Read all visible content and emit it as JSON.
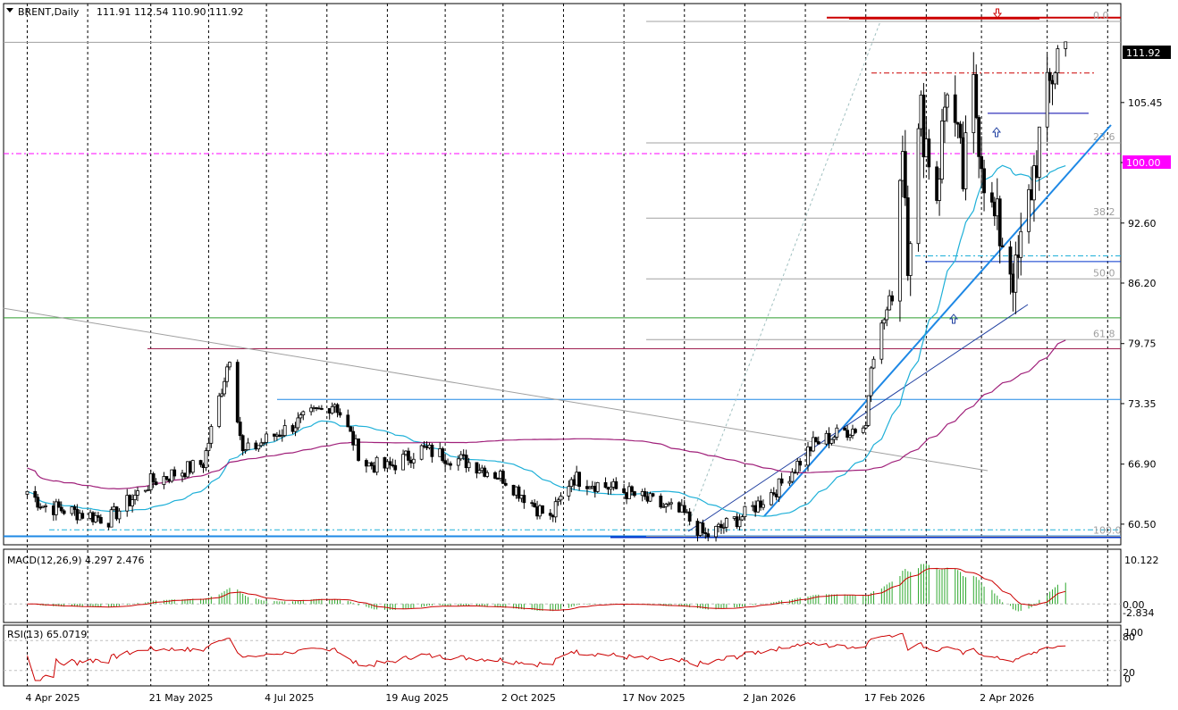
{
  "header": {
    "symbol_label": "BRENT,Daily",
    "ohlc": "111.91 112.54 110.90 111.92"
  },
  "macd_panel": {
    "label": "MACD(12,26,9) 4.297 2.476",
    "ticks": [
      "10.122",
      "0.00",
      "-2.834"
    ]
  },
  "rsi_panel": {
    "label": "RSI(13) 65.0719",
    "ticks": [
      "100",
      "80",
      "20",
      "0"
    ]
  },
  "levels": {
    "price_badge": "111.92",
    "round_badge": "100.00"
  },
  "fib_labels": [
    "0.0",
    "23.6",
    "38.2",
    "50.0",
    "61.8",
    "100.0"
  ],
  "colors": {
    "bull": "#000000",
    "bear": "#000000",
    "ma_fast": "#1fb0d8",
    "ma_slow": "#a0207a",
    "trend_blue": "#1e88e5",
    "support": "#0033cc",
    "resistance": "#cc0000",
    "round_level": "#ff00ff",
    "macd_hist": "#2ea82e",
    "macd_signal": "#cc0000",
    "rsi_line": "#cc0000"
  },
  "icons": {
    "up_arrow": "up-arrow-icon",
    "down_arrow": "down-arrow-icon",
    "menu": "chevron-down-icon"
  },
  "chart_data": {
    "type": "candlestick",
    "y_ticks": [
      "111.92",
      "105.45",
      "99.05",
      "92.60",
      "86.20",
      "79.75",
      "73.35",
      "66.90",
      "60.50"
    ],
    "x_ticks": [
      "4 Apr 2025",
      "21 May 2025",
      "4 Jul 2025",
      "19 Aug 2025",
      "2 Oct 2025",
      "17 Nov 2025",
      "2 Jan 2026",
      "17 Feb 2026",
      "2 Apr 2026"
    ],
    "ylim": [
      58.3,
      116.0
    ],
    "last_close": 111.92,
    "grid": "vertical-dashed",
    "series": [
      {
        "name": "BRENT,Daily"
      }
    ],
    "anchors": [
      {
        "date": "2025-04-04",
        "price": 64.0
      },
      {
        "date": "2025-04-10",
        "price": 62.5
      },
      {
        "date": "2025-05-05",
        "price": 61.0
      },
      {
        "date": "2025-05-21",
        "price": 65.0
      },
      {
        "date": "2025-06-10",
        "price": 67.0
      },
      {
        "date": "2025-06-20",
        "price": 78.5
      },
      {
        "date": "2025-06-25",
        "price": 68.0
      },
      {
        "date": "2025-07-04",
        "price": 69.5
      },
      {
        "date": "2025-07-30",
        "price": 73.5
      },
      {
        "date": "2025-08-10",
        "price": 67.0
      },
      {
        "date": "2025-08-19",
        "price": 66.5
      },
      {
        "date": "2025-09-01",
        "price": 68.5
      },
      {
        "date": "2025-09-20",
        "price": 67.0
      },
      {
        "date": "2025-10-02",
        "price": 65.5
      },
      {
        "date": "2025-10-20",
        "price": 61.0
      },
      {
        "date": "2025-10-28",
        "price": 65.5
      },
      {
        "date": "2025-11-17",
        "price": 64.0
      },
      {
        "date": "2025-12-10",
        "price": 61.5
      },
      {
        "date": "2025-12-18",
        "price": 59.2
      },
      {
        "date": "2026-01-02",
        "price": 61.5
      },
      {
        "date": "2026-01-15",
        "price": 64.5
      },
      {
        "date": "2026-01-28",
        "price": 69.0
      },
      {
        "date": "2026-02-10",
        "price": 70.5
      },
      {
        "date": "2026-02-17",
        "price": 71.0
      },
      {
        "date": "2026-02-19",
        "price": 78.0
      },
      {
        "date": "2026-02-27",
        "price": 85.0
      },
      {
        "date": "2026-03-03",
        "price": 102.0
      },
      {
        "date": "2026-03-05",
        "price": 90.0
      },
      {
        "date": "2026-03-10",
        "price": 104.0
      },
      {
        "date": "2026-03-16",
        "price": 96.0
      },
      {
        "date": "2026-03-20",
        "price": 108.0
      },
      {
        "date": "2026-03-26",
        "price": 97.0
      },
      {
        "date": "2026-03-30",
        "price": 106.5
      },
      {
        "date": "2026-04-05",
        "price": 94.0
      },
      {
        "date": "2026-04-10",
        "price": 91.0
      },
      {
        "date": "2026-04-15",
        "price": 86.5
      },
      {
        "date": "2026-04-24",
        "price": 101.5
      },
      {
        "date": "2026-04-29",
        "price": 108.5
      },
      {
        "date": "2026-05-02",
        "price": 112.0
      },
      {
        "date": "2026-05-04",
        "price": 111.92
      }
    ],
    "support_levels": [
      59.2,
      88.5
    ],
    "resistance_level": 114.5,
    "round_level": 100.0
  }
}
